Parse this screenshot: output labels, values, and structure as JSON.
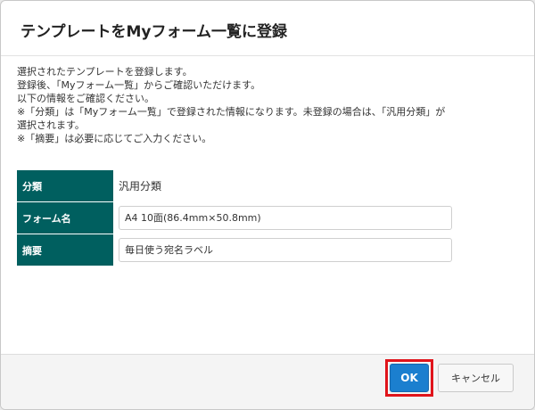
{
  "dialog": {
    "title": "テンプレートをMyフォーム一覧に登録",
    "description": [
      "選択されたテンプレートを登録します。",
      "登録後、「Myフォーム一覧」からご確認いただけます。",
      "以下の情報をご確認ください。",
      "※「分類」は「Myフォーム一覧」で登録された情報になります。未登録の場合は、「汎用分類」が",
      "選択されます。",
      "※「摘要」は必要に応じてご入力ください。"
    ],
    "form": {
      "category_label": "分類",
      "category_value": "汎用分類",
      "form_name_label": "フォーム名",
      "form_name_value": "A4 10面(86.4mm×50.8mm)",
      "summary_label": "摘要",
      "summary_value": "毎日使う宛名ラベル"
    },
    "buttons": {
      "ok_label": "OK",
      "cancel_label": "キャンセル"
    }
  },
  "colors": {
    "label_bg": "#005f5f",
    "primary_button": "#1b7fcf",
    "highlight": "#e0141b"
  }
}
